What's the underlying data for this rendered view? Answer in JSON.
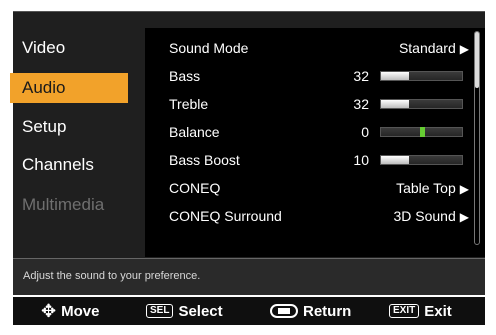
{
  "sidebar": {
    "items": [
      {
        "label": "Video"
      },
      {
        "label": "Audio"
      },
      {
        "label": "Setup"
      },
      {
        "label": "Channels"
      },
      {
        "label": "Multimedia"
      }
    ]
  },
  "audio": {
    "sound_mode": {
      "label": "Sound Mode",
      "value": "Standard"
    },
    "bass": {
      "label": "Bass",
      "value": "32",
      "level": 0.35
    },
    "treble": {
      "label": "Treble",
      "value": "32",
      "level": 0.35
    },
    "balance": {
      "label": "Balance",
      "value": "0",
      "level": 0.5
    },
    "bass_boost": {
      "label": "Bass Boost",
      "value": "10",
      "level": 0.35
    },
    "coneq": {
      "label": "CONEQ",
      "value": "Table Top"
    },
    "coneq_surround": {
      "label": "CONEQ Surround",
      "value": "3D Sound"
    }
  },
  "help": {
    "text": "Adjust the sound to your preference."
  },
  "footer": {
    "move": "Move",
    "select_badge": "SEL",
    "select": "Select",
    "return": "Return",
    "exit_badge": "EXIT",
    "exit": "Exit"
  },
  "colors": {
    "accent": "#f2a22a",
    "balance_marker": "#66cc33"
  },
  "glyphs": {
    "arrow_right": "▶",
    "move": "✥"
  }
}
